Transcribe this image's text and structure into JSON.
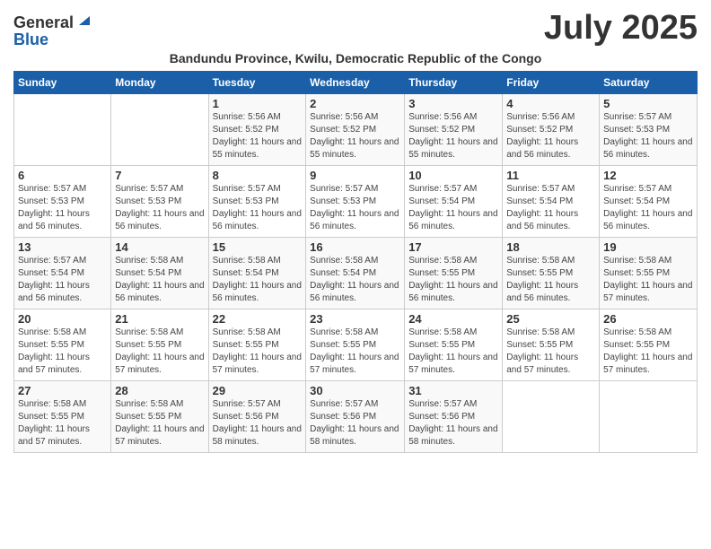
{
  "logo": {
    "general": "General",
    "blue": "Blue"
  },
  "title": "July 2025",
  "subtitle": "Bandundu Province, Kwilu, Democratic Republic of the Congo",
  "days_of_week": [
    "Sunday",
    "Monday",
    "Tuesday",
    "Wednesday",
    "Thursday",
    "Friday",
    "Saturday"
  ],
  "weeks": [
    [
      {
        "day": "",
        "info": ""
      },
      {
        "day": "",
        "info": ""
      },
      {
        "day": "1",
        "info": "Sunrise: 5:56 AM\nSunset: 5:52 PM\nDaylight: 11 hours and 55 minutes."
      },
      {
        "day": "2",
        "info": "Sunrise: 5:56 AM\nSunset: 5:52 PM\nDaylight: 11 hours and 55 minutes."
      },
      {
        "day": "3",
        "info": "Sunrise: 5:56 AM\nSunset: 5:52 PM\nDaylight: 11 hours and 55 minutes."
      },
      {
        "day": "4",
        "info": "Sunrise: 5:56 AM\nSunset: 5:52 PM\nDaylight: 11 hours and 56 minutes."
      },
      {
        "day": "5",
        "info": "Sunrise: 5:57 AM\nSunset: 5:53 PM\nDaylight: 11 hours and 56 minutes."
      }
    ],
    [
      {
        "day": "6",
        "info": "Sunrise: 5:57 AM\nSunset: 5:53 PM\nDaylight: 11 hours and 56 minutes."
      },
      {
        "day": "7",
        "info": "Sunrise: 5:57 AM\nSunset: 5:53 PM\nDaylight: 11 hours and 56 minutes."
      },
      {
        "day": "8",
        "info": "Sunrise: 5:57 AM\nSunset: 5:53 PM\nDaylight: 11 hours and 56 minutes."
      },
      {
        "day": "9",
        "info": "Sunrise: 5:57 AM\nSunset: 5:53 PM\nDaylight: 11 hours and 56 minutes."
      },
      {
        "day": "10",
        "info": "Sunrise: 5:57 AM\nSunset: 5:54 PM\nDaylight: 11 hours and 56 minutes."
      },
      {
        "day": "11",
        "info": "Sunrise: 5:57 AM\nSunset: 5:54 PM\nDaylight: 11 hours and 56 minutes."
      },
      {
        "day": "12",
        "info": "Sunrise: 5:57 AM\nSunset: 5:54 PM\nDaylight: 11 hours and 56 minutes."
      }
    ],
    [
      {
        "day": "13",
        "info": "Sunrise: 5:57 AM\nSunset: 5:54 PM\nDaylight: 11 hours and 56 minutes."
      },
      {
        "day": "14",
        "info": "Sunrise: 5:58 AM\nSunset: 5:54 PM\nDaylight: 11 hours and 56 minutes."
      },
      {
        "day": "15",
        "info": "Sunrise: 5:58 AM\nSunset: 5:54 PM\nDaylight: 11 hours and 56 minutes."
      },
      {
        "day": "16",
        "info": "Sunrise: 5:58 AM\nSunset: 5:54 PM\nDaylight: 11 hours and 56 minutes."
      },
      {
        "day": "17",
        "info": "Sunrise: 5:58 AM\nSunset: 5:55 PM\nDaylight: 11 hours and 56 minutes."
      },
      {
        "day": "18",
        "info": "Sunrise: 5:58 AM\nSunset: 5:55 PM\nDaylight: 11 hours and 56 minutes."
      },
      {
        "day": "19",
        "info": "Sunrise: 5:58 AM\nSunset: 5:55 PM\nDaylight: 11 hours and 57 minutes."
      }
    ],
    [
      {
        "day": "20",
        "info": "Sunrise: 5:58 AM\nSunset: 5:55 PM\nDaylight: 11 hours and 57 minutes."
      },
      {
        "day": "21",
        "info": "Sunrise: 5:58 AM\nSunset: 5:55 PM\nDaylight: 11 hours and 57 minutes."
      },
      {
        "day": "22",
        "info": "Sunrise: 5:58 AM\nSunset: 5:55 PM\nDaylight: 11 hours and 57 minutes."
      },
      {
        "day": "23",
        "info": "Sunrise: 5:58 AM\nSunset: 5:55 PM\nDaylight: 11 hours and 57 minutes."
      },
      {
        "day": "24",
        "info": "Sunrise: 5:58 AM\nSunset: 5:55 PM\nDaylight: 11 hours and 57 minutes."
      },
      {
        "day": "25",
        "info": "Sunrise: 5:58 AM\nSunset: 5:55 PM\nDaylight: 11 hours and 57 minutes."
      },
      {
        "day": "26",
        "info": "Sunrise: 5:58 AM\nSunset: 5:55 PM\nDaylight: 11 hours and 57 minutes."
      }
    ],
    [
      {
        "day": "27",
        "info": "Sunrise: 5:58 AM\nSunset: 5:55 PM\nDaylight: 11 hours and 57 minutes."
      },
      {
        "day": "28",
        "info": "Sunrise: 5:58 AM\nSunset: 5:55 PM\nDaylight: 11 hours and 57 minutes."
      },
      {
        "day": "29",
        "info": "Sunrise: 5:57 AM\nSunset: 5:56 PM\nDaylight: 11 hours and 58 minutes."
      },
      {
        "day": "30",
        "info": "Sunrise: 5:57 AM\nSunset: 5:56 PM\nDaylight: 11 hours and 58 minutes."
      },
      {
        "day": "31",
        "info": "Sunrise: 5:57 AM\nSunset: 5:56 PM\nDaylight: 11 hours and 58 minutes."
      },
      {
        "day": "",
        "info": ""
      },
      {
        "day": "",
        "info": ""
      }
    ]
  ]
}
